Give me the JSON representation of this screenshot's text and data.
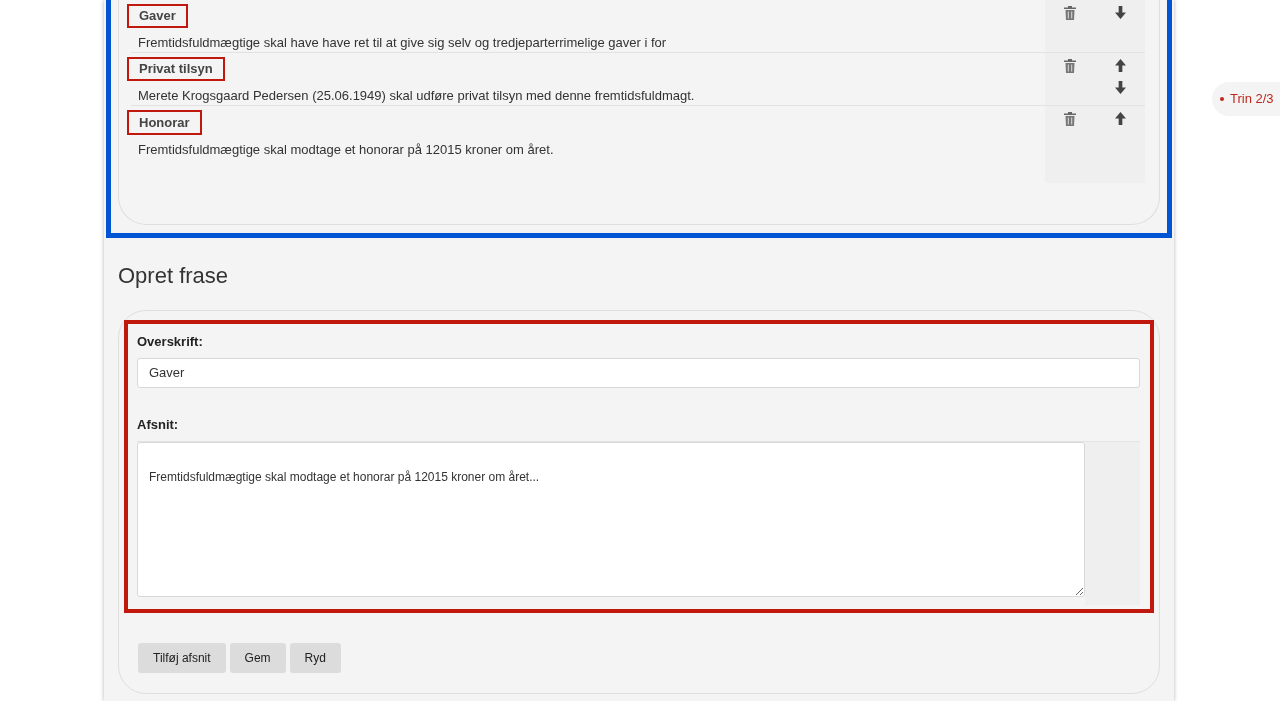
{
  "phrases": [
    {
      "title": "Gaver",
      "text": "Fremtidsfuldmægtige skal have have ret til at give sig selv og tredjeparterrimelige gaver i for",
      "move_up": false,
      "move_down": true
    },
    {
      "title": "Privat tilsyn",
      "text": "Merete Krogsgaard Pedersen (25.06.1949) skal udføre privat tilsyn med denne fremtidsfuldmagt.",
      "move_up": true,
      "move_down": true
    },
    {
      "title": "Honorar",
      "text": "Fremtidsfuldmægtige skal modtage et honorar på 12015 kroner om året.",
      "move_up": true,
      "move_down": false
    }
  ],
  "step": "Trin 2/3",
  "form": {
    "heading": "Opret frase",
    "title_label": "Overskrift:",
    "title_value": "Gaver",
    "section_label": "Afsnit:",
    "section_value": "Fremtidsfuldmægtige skal modtage et honorar på 12015 kroner om året...",
    "buttons": [
      "Tilføj afsnit",
      "Gem",
      "Ryd"
    ]
  }
}
